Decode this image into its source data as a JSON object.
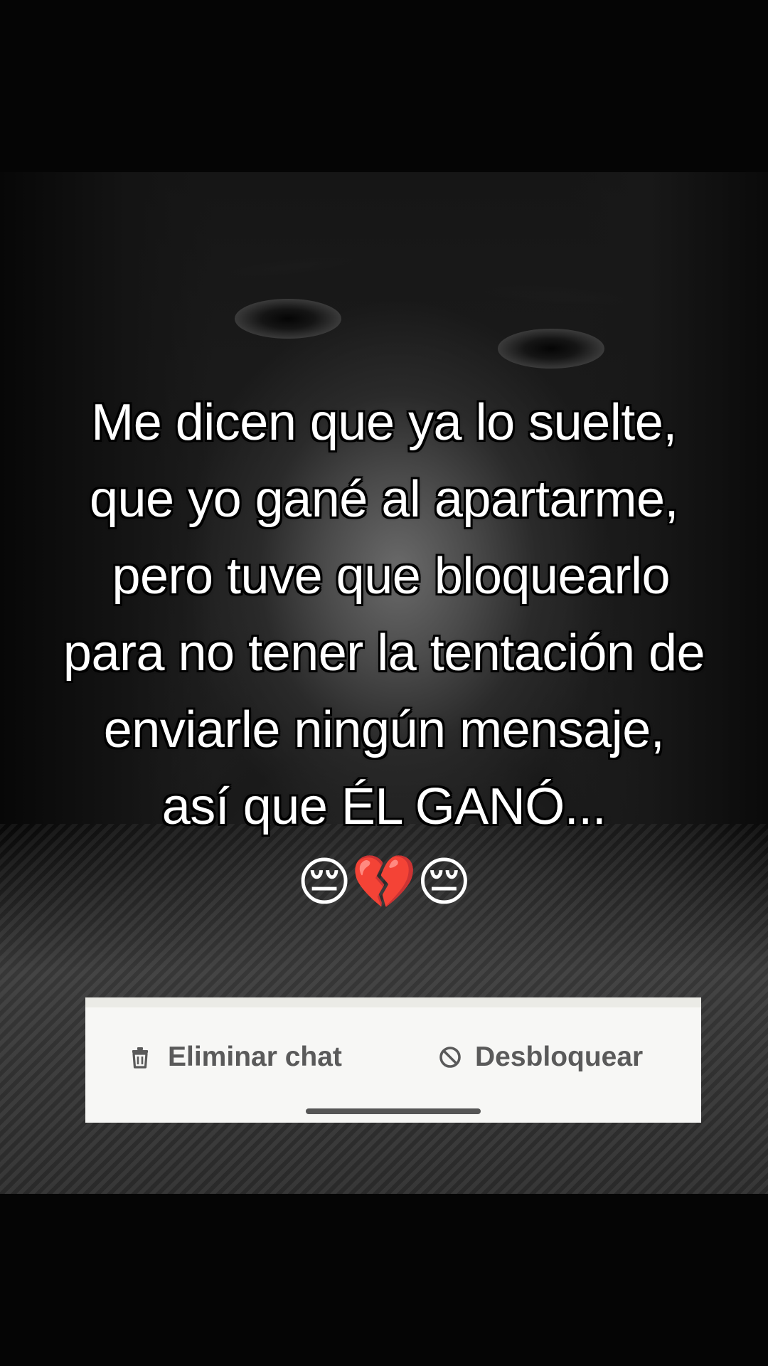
{
  "caption": {
    "lines": [
      "Me dicen que ya lo suelte,",
      "que yo gané al apartarme,",
      " pero tuve que bloquearlo",
      "para no tener la tentación de",
      "enviarle ningún mensaje,",
      "así que ÉL GANÓ..."
    ],
    "emoji": "😔💔😔"
  },
  "blocked_bar": {
    "delete_label": "Eliminar chat",
    "delete_icon": "trash-icon",
    "unblock_label": "Desbloquear",
    "unblock_icon": "block-icon"
  },
  "colors": {
    "background": "#050505",
    "caption_text": "#ffffff",
    "caption_outline": "#000000",
    "bar_background": "#f7f7f5",
    "action_text": "#5a5a5a"
  }
}
